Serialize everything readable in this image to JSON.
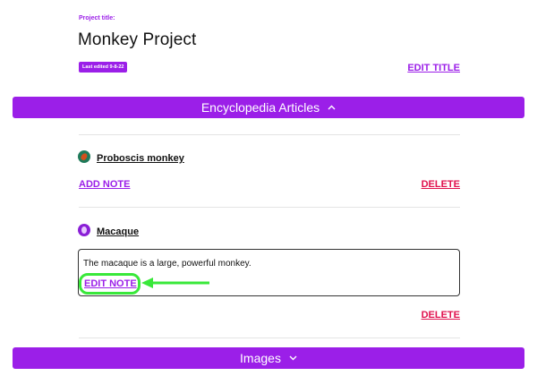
{
  "project": {
    "label": "Project title:",
    "title": "Monkey Project",
    "last_edited": "Last edited 9-8-22",
    "edit_title_label": "EDIT TITLE"
  },
  "sections": {
    "articles": {
      "label": "Encyclopedia Articles",
      "icon": "chevron-up-icon"
    },
    "images": {
      "label": "Images",
      "icon": "chevron-down-icon"
    }
  },
  "articles": [
    {
      "title": "Proboscis monkey",
      "icon": "proboscis-monkey-icon",
      "add_note_label": "ADD NOTE",
      "delete_label": "DELETE"
    },
    {
      "title": "Macaque",
      "icon": "macaque-icon",
      "note": "The macaque is a large, powerful monkey.",
      "edit_note_label": "EDIT NOTE",
      "delete_label": "DELETE"
    }
  ],
  "colors": {
    "accent": "#9b1fe8",
    "delete": "#e0114e",
    "annotation": "#39e83a"
  }
}
